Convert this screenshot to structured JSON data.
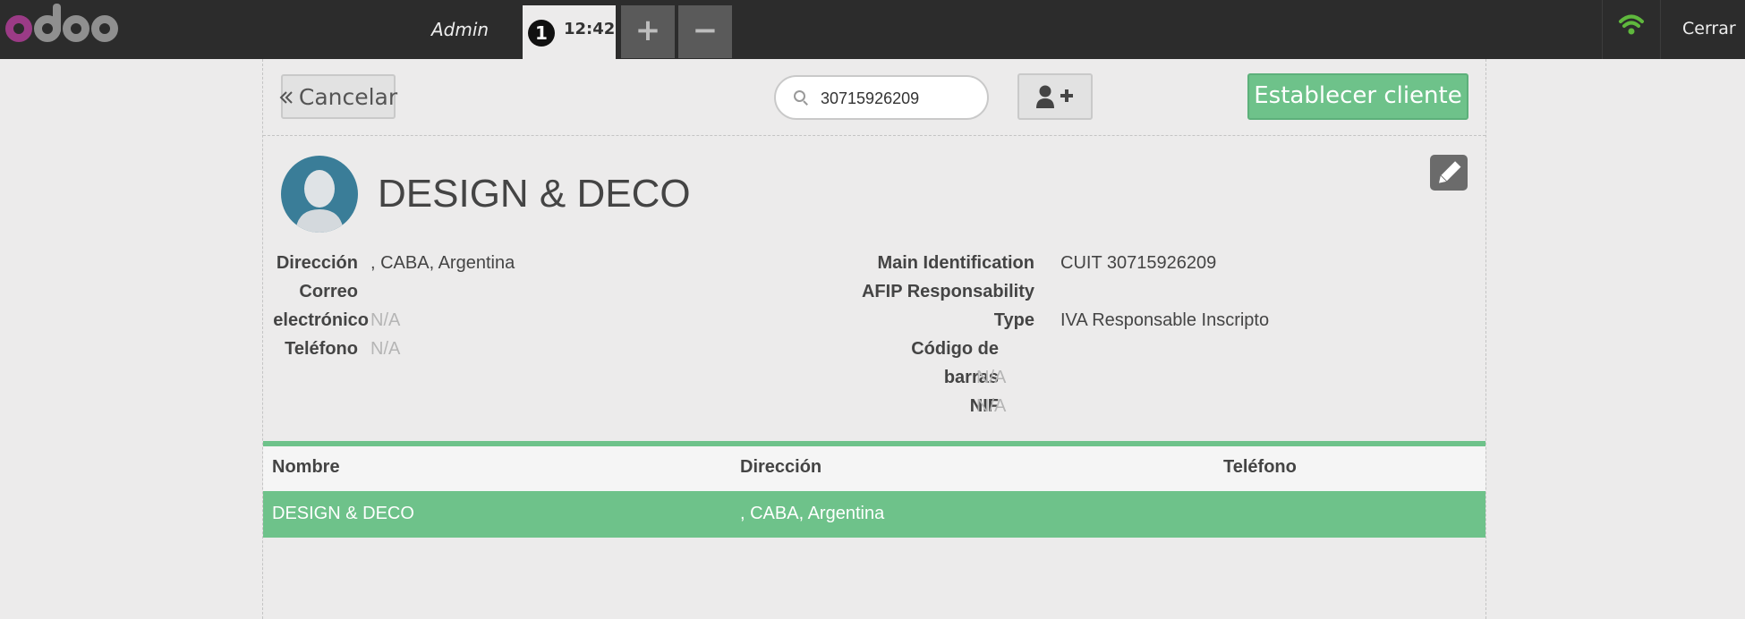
{
  "topbar": {
    "user": "Admin",
    "order_number": "1",
    "order_time": "12:42",
    "add_order": "+",
    "remove_order": "−",
    "close_label": "Cerrar"
  },
  "toolbar": {
    "cancel_label": "Cancelar",
    "search_value": "30715926209",
    "set_customer_label": "Establecer cliente"
  },
  "customer": {
    "name": "DESIGN & DECO",
    "left_fields": [
      {
        "label": "Dirección",
        "value": ", CABA, Argentina"
      },
      {
        "label": "Correo",
        "label2": "electrónico",
        "value": "N/A"
      },
      {
        "label": "Teléfono",
        "value": "N/A"
      }
    ],
    "right_fields": [
      {
        "label": "Main Identification",
        "value": "CUIT 30715926209"
      },
      {
        "label": "AFIP Responsability",
        "value": ""
      },
      {
        "label": "Type",
        "value": "IVA Responsable Inscripto"
      },
      {
        "label": "Código de",
        "label2": "barras",
        "value": "N/A"
      },
      {
        "label": "NIF",
        "value": "N/A"
      }
    ]
  },
  "table": {
    "headers": [
      "Nombre",
      "Dirección",
      "Teléfono"
    ],
    "rows": [
      {
        "name": "DESIGN & DECO",
        "address": ", CABA, Argentina",
        "phone": ""
      }
    ]
  },
  "colors": {
    "accent": "#6ec28a",
    "topbar": "#2c2c2c",
    "wifi": "#5fb83d",
    "logo_purple": "#9b3b86"
  }
}
